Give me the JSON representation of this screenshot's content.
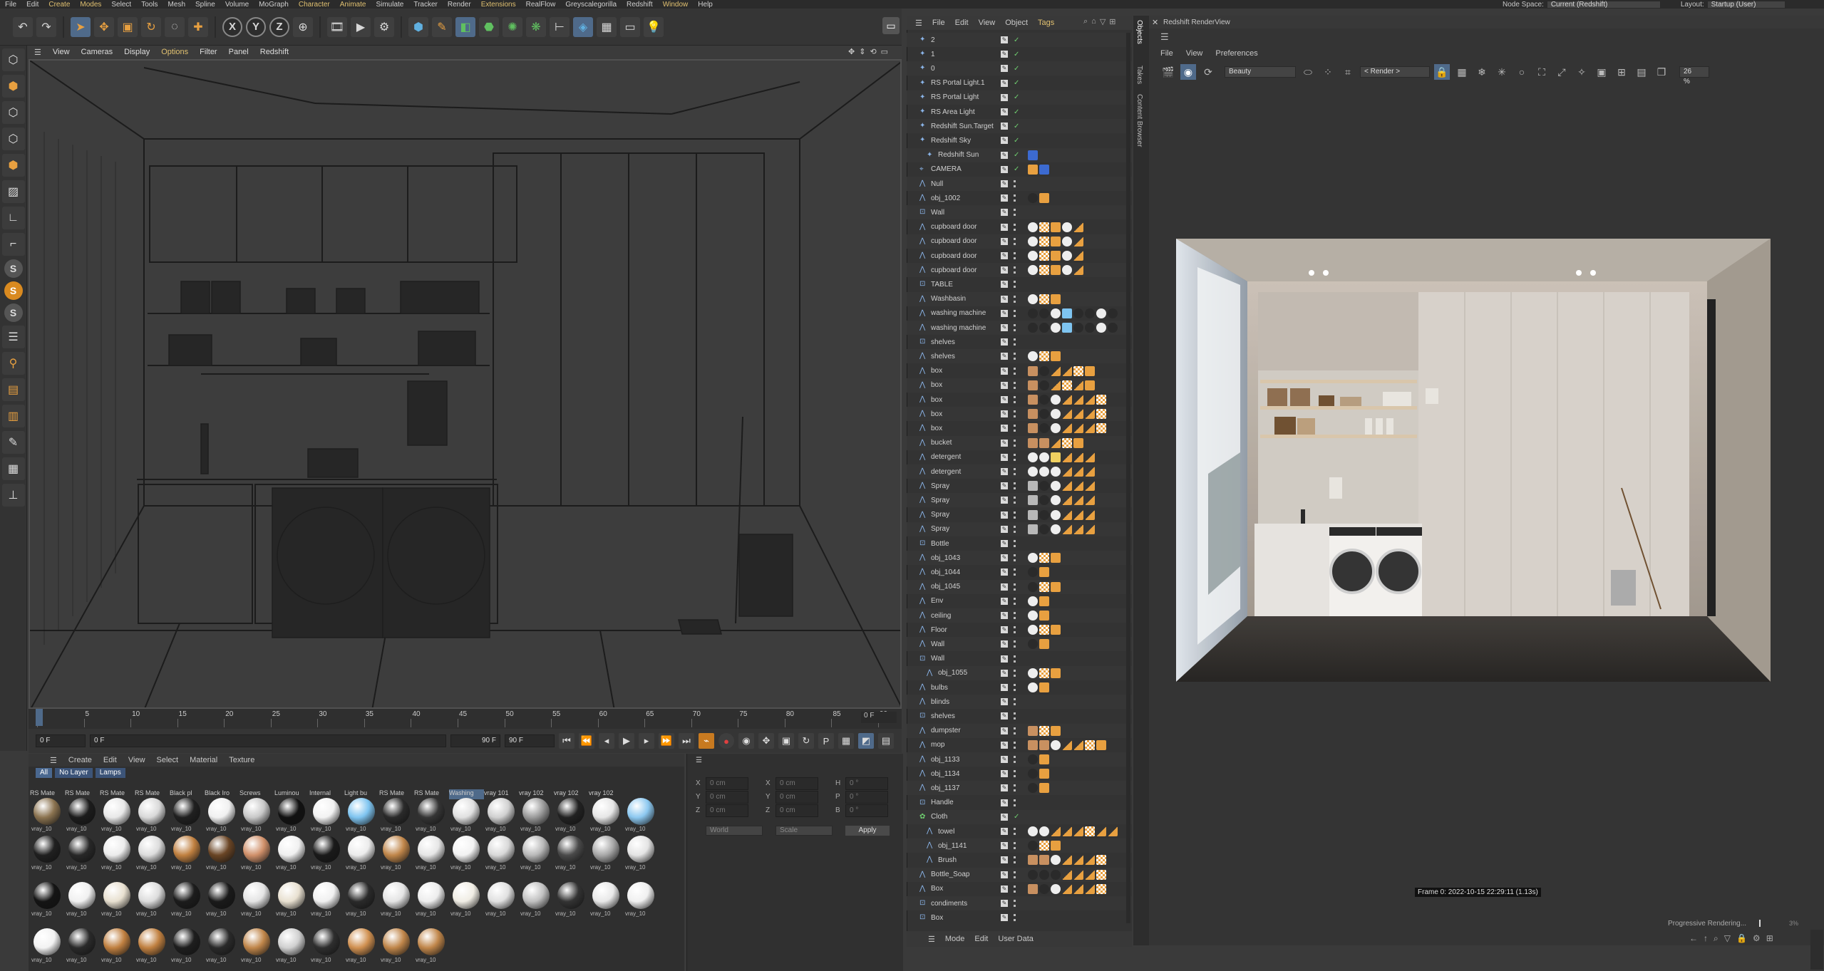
{
  "menubar": {
    "items": [
      "File",
      "Edit",
      "Create",
      "Modes",
      "Select",
      "Tools",
      "Mesh",
      "Spline",
      "Volume",
      "MoGraph",
      "Character",
      "Animate",
      "Simulate",
      "Tracker",
      "Render",
      "Extensions",
      "RealFlow",
      "Greyscalegorilla",
      "Redshift",
      "Window",
      "Help"
    ],
    "node_space_label": "Node Space:",
    "node_space_value": "Current (Redshift)",
    "layout_label": "Layout:",
    "layout_value": "Startup (User)"
  },
  "toolbar": {
    "axis_x": "X",
    "axis_y": "Y",
    "axis_z": "Z"
  },
  "viewport": {
    "menu": [
      "View",
      "Cameras",
      "Display",
      "Options",
      "Filter",
      "Panel",
      "Redshift"
    ]
  },
  "timeline": {
    "ticks": [
      "0",
      "5",
      "10",
      "15",
      "20",
      "25",
      "30",
      "35",
      "40",
      "45",
      "50",
      "55",
      "60",
      "65",
      "70",
      "75",
      "80",
      "85",
      "90"
    ],
    "end_label": "0 F",
    "start_field": "0 F",
    "current_field": "0 F",
    "end_field": "90 F",
    "max_field": "90 F"
  },
  "materials": {
    "menu": [
      "Create",
      "Edit",
      "View",
      "Select",
      "Material",
      "Texture"
    ],
    "filters": [
      "All",
      "No Layer",
      "Lamps"
    ],
    "row1_labels": [
      "RS Mate",
      "RS Mate",
      "RS Mate",
      "RS Mate",
      "Black pl",
      "Black Iro",
      "Screws",
      "Luminou",
      "Internal",
      "Light bu",
      "RS Mate",
      "RS Mate",
      "Washing",
      "vray 101",
      "vray 102",
      "vray 102",
      "vray 102"
    ],
    "cell_label": "vray_10"
  },
  "attributes": {
    "labels": [
      "X",
      "Y",
      "Z",
      "H",
      "P",
      "B"
    ],
    "values": [
      "0 cm",
      "0 cm",
      "0 cm",
      "0 cm",
      "0 cm",
      "0 cm",
      "0 °",
      "0 °",
      "0 °"
    ],
    "world": "World",
    "scale": "Scale",
    "apply": "Apply"
  },
  "objects": {
    "menu": [
      "File",
      "Edit",
      "View",
      "Object",
      "Tags"
    ],
    "rows": [
      "2",
      "1",
      "0",
      "RS Portal Light.1",
      "RS Portal Light",
      "RS Area Light",
      "Redshift Sun.Target",
      "Redshift Sky",
      "Redshift Sun",
      "CAMERA",
      "Null",
      "obj_1002",
      "Wall",
      "cupboard door",
      "cupboard door",
      "cupboard door",
      "cupboard door",
      "TABLE",
      "Washbasin",
      "washing machine",
      "washing machine",
      "shelves",
      "shelves",
      "box",
      "box",
      "box",
      "box",
      "box",
      "bucket",
      "detergent",
      "detergent",
      "Spray",
      "Spray",
      "Spray",
      "Spray",
      "Bottle",
      "obj_1043",
      "obj_1044",
      "obj_1045",
      "Env",
      "ceiling",
      "Floor",
      "Wall",
      "Wall",
      "obj_1055",
      "bulbs",
      "blinds",
      "shelves",
      "dumpster",
      "mop",
      "obj_1133",
      "obj_1134",
      "obj_1137",
      "Handle",
      "Cloth",
      "towel",
      "obj_1141",
      "Brush",
      "Bottle_Soap",
      "Box",
      "condiments",
      "Box"
    ],
    "bottom_menu": [
      "Mode",
      "Edit",
      "User Data"
    ]
  },
  "sidetabs": [
    "Objects",
    "Takes",
    "Content Browser"
  ],
  "renderview": {
    "title": "Redshift RenderView",
    "menu": [
      "File",
      "View",
      "Preferences"
    ],
    "aov": "Beauty",
    "render_dropdown": "< Render >",
    "zoom": "26 %",
    "frame_info": "Frame  0:  2022-10-15  22:29:11  (1.13s)",
    "progress": "Progressive Rendering...",
    "progress_pct": "3%"
  },
  "colors": {
    "accent": "#4f6a8a",
    "orange": "#e8a040",
    "check": "#6fce6f"
  }
}
